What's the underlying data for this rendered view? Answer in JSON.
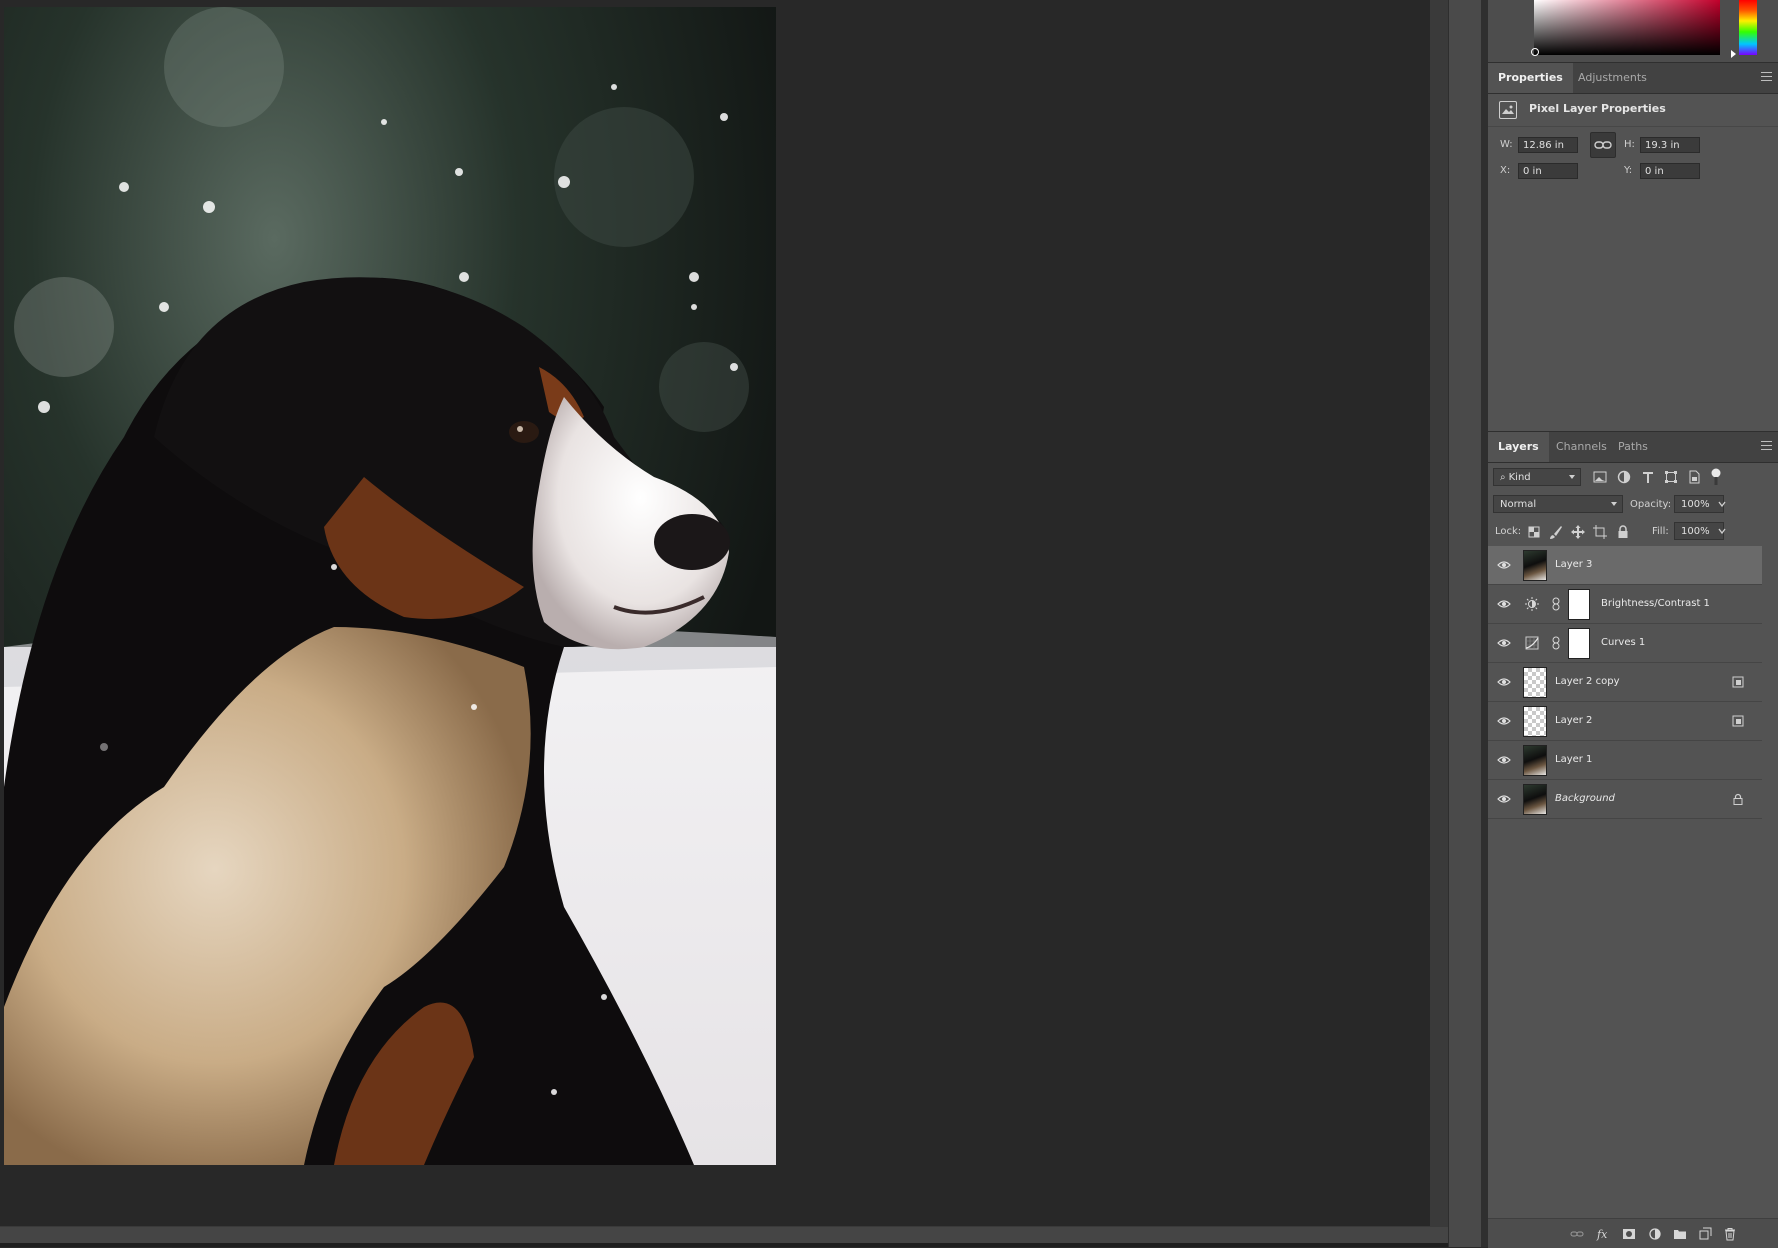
{
  "properties_panel": {
    "tabs": [
      {
        "label": "Properties",
        "active": true
      },
      {
        "label": "Adjustments",
        "active": false
      }
    ],
    "header_title": "Pixel Layer Properties",
    "width_label": "W:",
    "width_value": "12.86 in",
    "height_label": "H:",
    "height_value": "19.3 in",
    "x_label": "X:",
    "x_value": "0 in",
    "y_label": "Y:",
    "y_value": "0 in"
  },
  "layers_panel": {
    "tabs": [
      {
        "label": "Layers",
        "active": true
      },
      {
        "label": "Channels",
        "active": false
      },
      {
        "label": "Paths",
        "active": false
      }
    ],
    "filter_kind": "Kind",
    "blend_mode": "Normal",
    "opacity_label": "Opacity:",
    "opacity_value": "100%",
    "lock_label": "Lock:",
    "fill_label": "Fill:",
    "fill_value": "100%",
    "layers": [
      {
        "name": "Layer 3",
        "type": "pixel",
        "selected": true
      },
      {
        "name": "Brightness/Contrast 1",
        "type": "adjustment",
        "icon": "brightness-contrast-icon"
      },
      {
        "name": "Curves 1",
        "type": "adjustment",
        "icon": "curves-icon"
      },
      {
        "name": "Layer 2 copy",
        "type": "transparent",
        "badge": "smart-object-icon"
      },
      {
        "name": "Layer 2",
        "type": "transparent",
        "badge": "smart-object-icon"
      },
      {
        "name": "Layer 1",
        "type": "pixel"
      },
      {
        "name": "Background",
        "type": "pixel",
        "badge": "lock-icon",
        "italic": true
      }
    ]
  },
  "colors": {
    "panel_bg": "#535353",
    "canvas_bg": "#282828",
    "selected_row": "#6a6a6a",
    "color_picker_hue": "#c2002b"
  }
}
